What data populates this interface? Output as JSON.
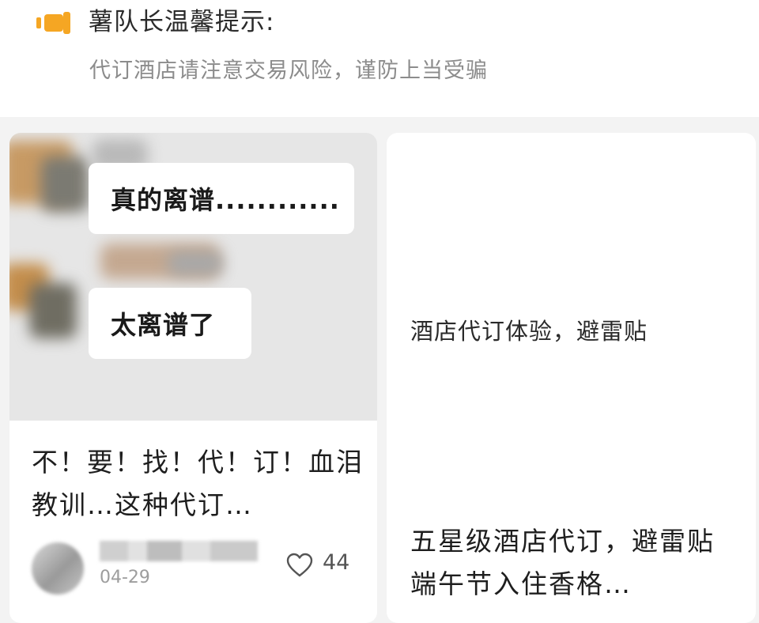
{
  "notice": {
    "icon": "megaphone-icon",
    "title": "薯队长温馨提示:",
    "body": "代订酒店请注意交易风险，谨防上当受骗",
    "accent_color": "#f5a623"
  },
  "feed": {
    "cards": [
      {
        "cover": {
          "bubble_1": "真的离谱............",
          "bubble_2": "太离谱了"
        },
        "title": "不！要！找！代！订！血泪教训…这种代订…",
        "author": {
          "date": "04-29"
        },
        "like_icon": "heart-outline-icon",
        "likes": "44"
      },
      {
        "cover_text": "酒店代订体验，避雷贴",
        "title": "五星级酒店代订，避雷贴 端午节入住香格…"
      }
    ]
  }
}
